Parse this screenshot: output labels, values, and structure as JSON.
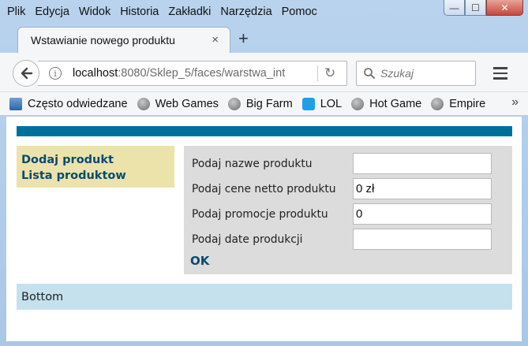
{
  "menubar": {
    "items": [
      "Plik",
      "Edycja",
      "Widok",
      "Historia",
      "Zakładki",
      "Narzędzia",
      "Pomoc"
    ]
  },
  "window_controls": {
    "minimize": "—",
    "maximize": "☐",
    "close": "✕"
  },
  "tab": {
    "title": "Wstawianie nowego produktu",
    "close": "×",
    "new_tab": "+"
  },
  "nav": {
    "url_host": "localhost",
    "url_rest": ":8080/Sklep_5/faces/warstwa_int",
    "search_placeholder": "Szukaj"
  },
  "bookmarks": {
    "items": [
      "Często odwiedzane",
      "Web Games",
      "Big Farm",
      "LOL",
      "Hot Game",
      "Empire"
    ],
    "more": "»"
  },
  "page": {
    "left_menu": {
      "add_product": "Dodaj produkt",
      "product_list": "Lista produktow"
    },
    "form": {
      "name_label": "Podaj nazwe produktu",
      "name_value": "",
      "price_label": "Podaj cene netto produktu",
      "price_value": "0 zł",
      "promo_label": "Podaj promocje produktu",
      "promo_value": "0",
      "date_label": "Podaj date produkcji",
      "date_value": "",
      "ok_label": "OK"
    },
    "footer": "Bottom"
  },
  "colors": {
    "topbar": "#00709b",
    "left_menu_bg": "#ebe3a9",
    "link": "#064b74",
    "form_bg": "#dcdcdc",
    "footer_bg": "#c5e1ee"
  }
}
